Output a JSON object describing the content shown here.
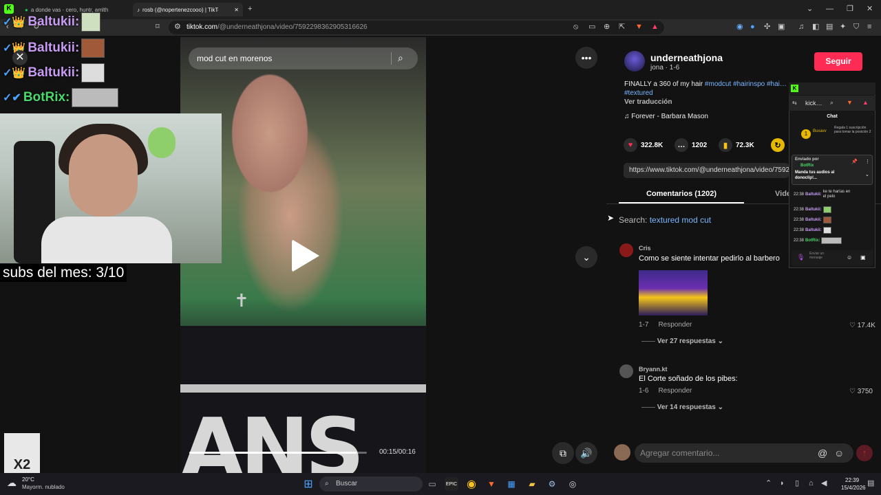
{
  "browser": {
    "tabs": [
      {
        "label": "a donde vas · cero, huntr, amlth",
        "active": false
      },
      {
        "label": "rosb (@nopertenezcooo) | TikTok",
        "active": true
      }
    ],
    "url_host": "tiktok.com",
    "url_path": "/@underneathjona/video/7592298362905316626"
  },
  "video": {
    "search_query": "mod cut en morenos",
    "time": "00:15/00:16",
    "progress": 0.94,
    "shirt_text": "ANS"
  },
  "stream_overlay": {
    "chat": [
      {
        "user": "Baltukii:",
        "badges": "✓👑"
      },
      {
        "user": "Baltukii:",
        "badges": "✓👑"
      },
      {
        "user": "Baltukii:",
        "badges": "✓👑"
      },
      {
        "user": "BotRix:",
        "badges": "✓✔"
      }
    ],
    "close_label": "✕",
    "subs": "subs del mes: 3/10",
    "multiplier": "X2"
  },
  "post": {
    "author": "underneathjona",
    "author_sub": "jona · 1-6",
    "follow_label": "Seguir",
    "desc_text": "FINALLY a 360 of my hair ",
    "tags": [
      "#modcut",
      "#hairinspo",
      "#hai…",
      "#textured"
    ],
    "translate": "Ver traducción",
    "music": "Forever - Barbara Mason",
    "likes": "322.8K",
    "comments": "1202",
    "saves": "72.3K",
    "link": "https://www.tiktok.com/@underneathjona/video/7592…",
    "tab_comments": "Comentarios (1202)",
    "tab_videos": "Vide",
    "search_prefix": "Search:",
    "search_related": "textured mod cut"
  },
  "comments": [
    {
      "name": "Cris",
      "text": "Como se siente intentar pedirlo al barbero",
      "date": "1-7",
      "reply": "Responder",
      "likes": "17.4K",
      "more": "Ver 27 respuestas"
    },
    {
      "name": "Bryann.kt",
      "text": "El Corte soñado de los pibes:",
      "date": "1-6",
      "reply": "Responder",
      "likes": "3750",
      "more": "Ver 14 respuestas"
    }
  ],
  "comment_input_placeholder": "Agregar comentario...",
  "kick": {
    "title": "kick…",
    "chat_label": "Chat",
    "top_user": "Buxavv",
    "top_note": "Regala 1 suscripción para tomar la posición 2",
    "pinned_by": "Enviado por",
    "pinned_user": "BotRix",
    "pinned_text": "Manda tus audios al donoclip!...",
    "lines": [
      {
        "time": "22:38",
        "user": "Baltukii:",
        "msg": "ke te harías en el pelo"
      },
      {
        "time": "22:38",
        "user": "Baltukii:",
        "msg": ""
      },
      {
        "time": "22:38",
        "user": "Baltukii:",
        "msg": ""
      },
      {
        "time": "22:38",
        "user": "Baltukii:",
        "msg": ""
      },
      {
        "time": "22:38",
        "user": "BotRix:",
        "msg": ""
      }
    ],
    "input_placeholder": "Enviar un mensaje"
  },
  "taskbar": {
    "search": "Buscar",
    "temp": "20°C",
    "weather": "Mayorm. nublado",
    "time": "22:39",
    "date": "15/4/2026"
  },
  "colors": {
    "accent": "#fe2c55",
    "kick_green": "#53fc18",
    "tag_blue": "#7ab6ff"
  }
}
